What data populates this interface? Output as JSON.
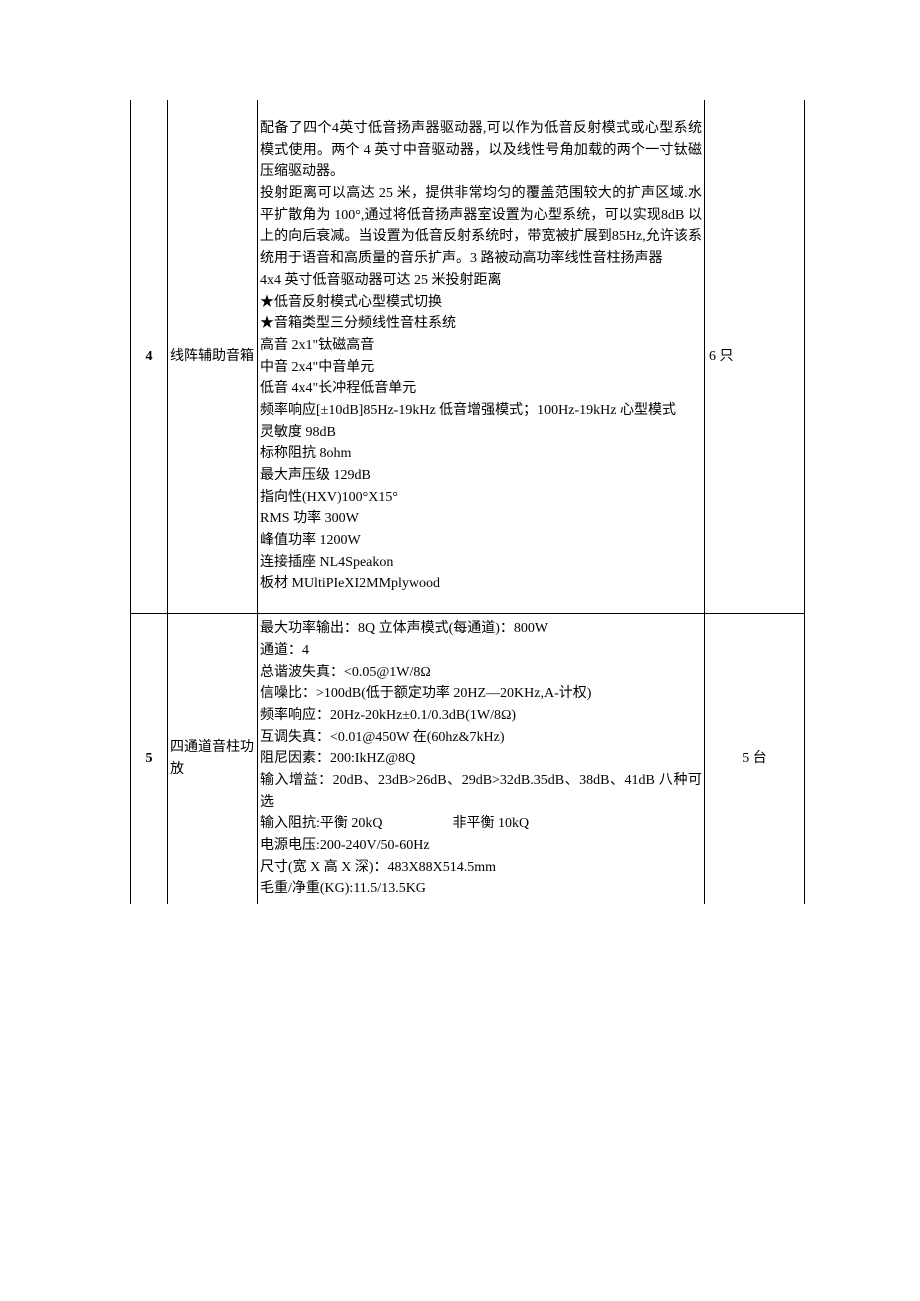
{
  "rows": [
    {
      "num": "4",
      "name": "线阵辅助音箱",
      "qty": "6 只",
      "desc": "配备了四个4英寸低音扬声器驱动器,可以作为低音反射模式或心型系统模式使用。两个 4 英寸中音驱动器，以及线性号角加载的两个一寸钛磁压缩驱动器。\n投射距离可以高达 25 米，提供非常均匀的覆盖范围较大的扩声区域.水平扩散角为 100°,通过将低音扬声器室设置为心型系统，可以实现8dB 以上的向后衰减。当设置为低音反射系统时，带宽被扩展到85Hz,允许该系统用于语音和高质量的音乐扩声。3 路被动高功率线性音柱扬声器\n4x4 英寸低音驱动器可达 25 米投射距离\n★低音反射模式心型模式切换\n★音箱类型三分频线性音柱系统\n高音 2x1\"钛磁高音\n中音 2x4\"中音单元\n低音 4x4\"长冲程低音单元\n频率响应[±10dB]85Hz-19kHz 低音增强模式；100Hz-19kHz 心型模式\n灵敏度 98dB\n标称阻抗 8ohm\n最大声压级 129dB\n指向性(HXV)100°X15°\nRMS 功率 300W\n峰值功率 1200W\n连接插座 NL4Speakon\n板材 MUltiPIeXI2MMplywood"
    },
    {
      "num": "5",
      "name": "四通道音柱功放",
      "qty": "5 台",
      "desc": "最大功率输出：8Q 立体声模式(每通道)：800W\n通道：4\n总谐波失真：<0.05@1W/8Ω\n信噪比：>100dB(低于额定功率 20HZ—20KHz,A-计权)\n频率响应：20Hz-20kHz±0.1/0.3dB(1W/8Ω)\n互调失真：<0.01@450W 在(60hz&7kHz)\n阻尼因素：200:IkHZ@8Q\n输入增益：20dB、23dB>26dB、29dB>32dB.35dB、38dB、41dB 八种可选\n输入阻抗:平衡 20kQ     非平衡 10kQ\n电源电压:200-240V/50-60Hz\n尺寸(宽 X 高 X 深)：483X88X514.5mm\n毛重/净重(KG):11.5/13.5KG"
    }
  ]
}
